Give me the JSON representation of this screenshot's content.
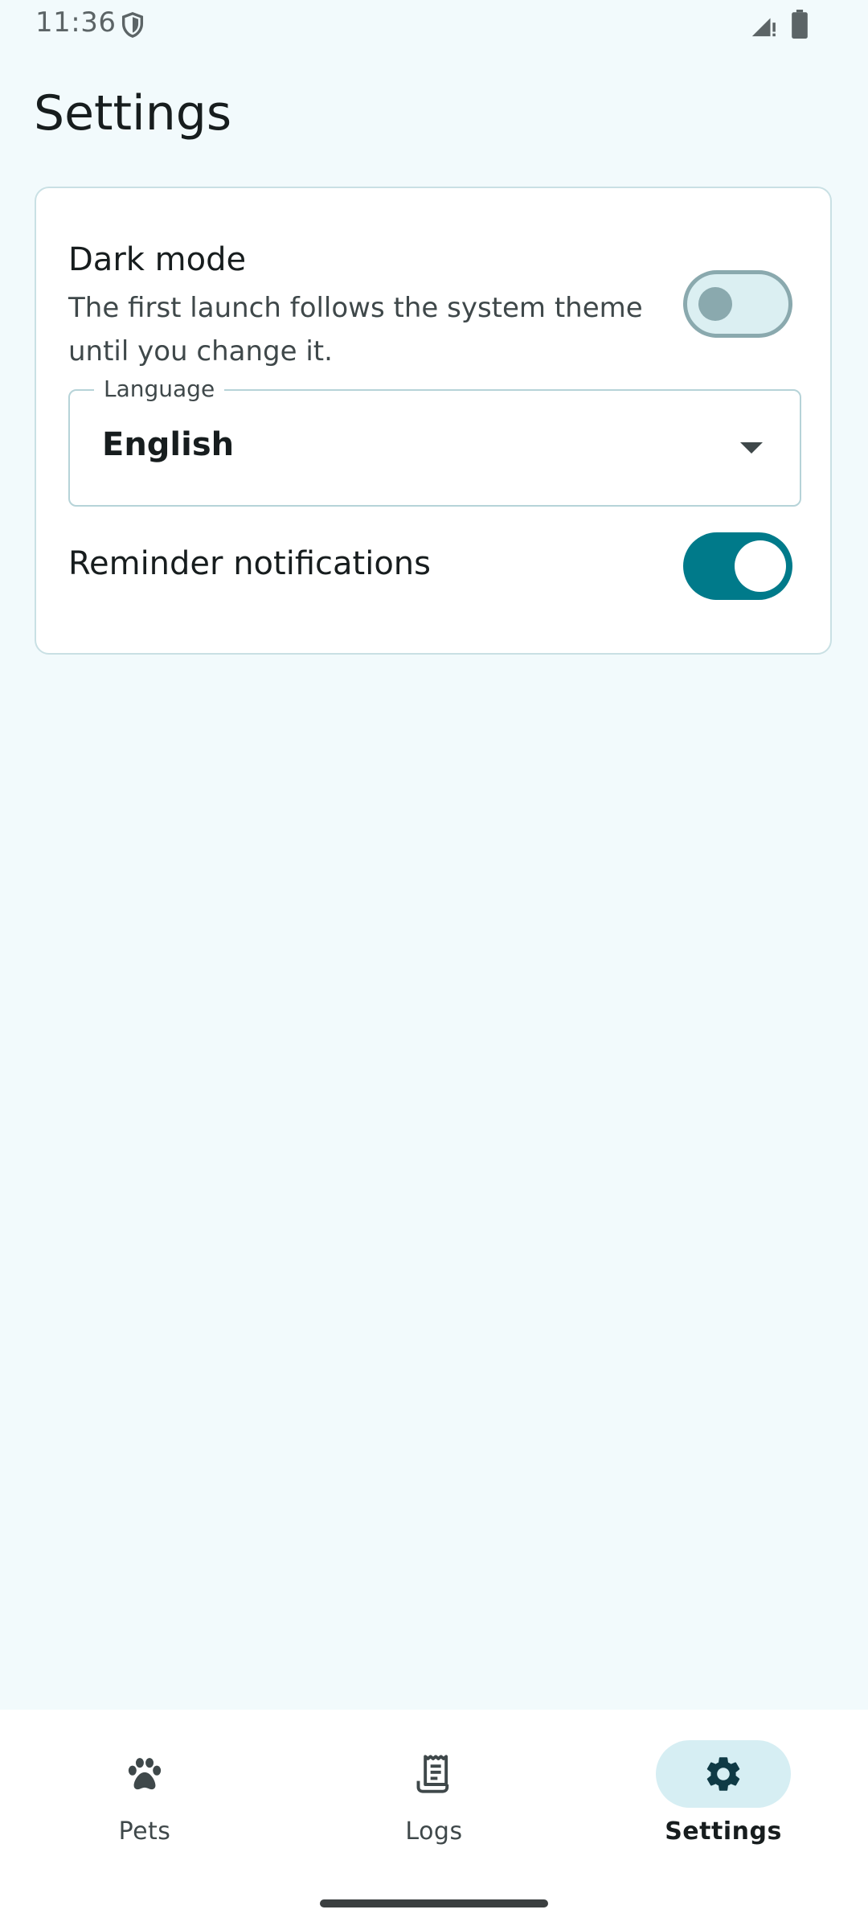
{
  "status_bar": {
    "time": "11:36"
  },
  "page": {
    "title": "Settings"
  },
  "settings": {
    "dark_mode": {
      "title": "Dark mode",
      "description": "The first launch follows the system theme until you change it.",
      "enabled": false
    },
    "language": {
      "label": "Language",
      "value": "English"
    },
    "reminder_notifications": {
      "title": "Reminder notifications",
      "enabled": true
    }
  },
  "bottom_nav": {
    "items": [
      {
        "label": "Pets",
        "icon": "paw-icon",
        "active": false
      },
      {
        "label": "Logs",
        "icon": "receipt-icon",
        "active": false
      },
      {
        "label": "Settings",
        "icon": "gear-icon",
        "active": true
      }
    ]
  },
  "colors": {
    "background": "#f2fafc",
    "accent": "#007a8a",
    "active_nav_pill": "#d6eef3"
  }
}
